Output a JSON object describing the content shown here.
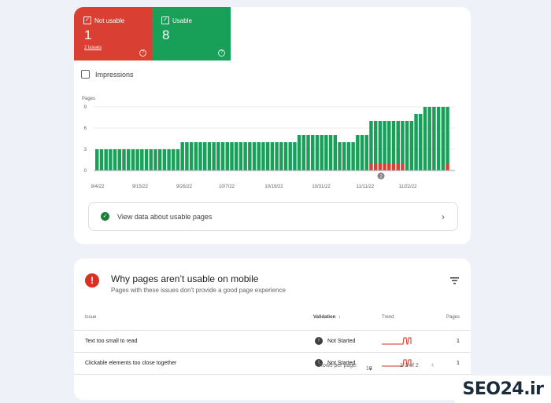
{
  "summary": {
    "not_usable": {
      "label": "Not usable",
      "count": "1",
      "issues_link": "2 issues",
      "color": "#d93f33"
    },
    "usable": {
      "label": "Usable",
      "count": "8",
      "color": "#18a058"
    }
  },
  "impressions_label": "Impressions",
  "chart_data": {
    "type": "bar",
    "ylabel": "Pages",
    "ylim": [
      0,
      9
    ],
    "yticks": [
      0,
      3,
      6,
      9
    ],
    "x_tick_labels": [
      "9/4/22",
      "9/15/22",
      "9/26/22",
      "10/7/22",
      "10/19/22",
      "10/31/22",
      "11/11/22",
      "11/22/22"
    ],
    "series": [
      {
        "name": "Usable",
        "color": "#18a058",
        "values": [
          3,
          3,
          3,
          3,
          3,
          3,
          3,
          3,
          3,
          3,
          3,
          3,
          3,
          3,
          3,
          3,
          3,
          3,
          3,
          4,
          4,
          4,
          4,
          4,
          4,
          4,
          4,
          4,
          4,
          4,
          4,
          4,
          4,
          4,
          4,
          4,
          4,
          4,
          4,
          4,
          4,
          4,
          4,
          4,
          4,
          5,
          5,
          5,
          5,
          5,
          5,
          5,
          5,
          5,
          4,
          4,
          4,
          4,
          5,
          5,
          5,
          6,
          6,
          6,
          6,
          6,
          6,
          6,
          6,
          7,
          7,
          8,
          8,
          9,
          9,
          9,
          9,
          9,
          8
        ]
      },
      {
        "name": "Not usable",
        "color": "#d93f33",
        "values": [
          0,
          0,
          0,
          0,
          0,
          0,
          0,
          0,
          0,
          0,
          0,
          0,
          0,
          0,
          0,
          0,
          0,
          0,
          0,
          0,
          0,
          0,
          0,
          0,
          0,
          0,
          0,
          0,
          0,
          0,
          0,
          0,
          0,
          0,
          0,
          0,
          0,
          0,
          0,
          0,
          0,
          0,
          0,
          0,
          0,
          0,
          0,
          0,
          0,
          0,
          0,
          0,
          0,
          0,
          0,
          0,
          0,
          0,
          0,
          0,
          0,
          1,
          1,
          1,
          1,
          1,
          1,
          1,
          1,
          0,
          0,
          0,
          0,
          0,
          0,
          0,
          0,
          0,
          1
        ]
      }
    ],
    "annotation": "2"
  },
  "usable_link_label": "View data about usable pages",
  "why": {
    "title": "Why pages aren’t usable on mobile",
    "subtitle": "Pages with these issues don’t provide a good page experience"
  },
  "table": {
    "headers": {
      "issue": "Issue",
      "validation": "Validation",
      "trend": "Trend",
      "pages": "Pages"
    },
    "rows": [
      {
        "issue": "Text too small to read",
        "validation": "Not Started",
        "pages": "1"
      },
      {
        "issue": "Clickable elements too close together",
        "validation": "Not Started",
        "pages": "1"
      }
    ]
  },
  "pager": {
    "rows_label": "Rows per page:",
    "rows_value": "10",
    "range": "1-2 of 2"
  },
  "watermark": "SEO24.ir"
}
